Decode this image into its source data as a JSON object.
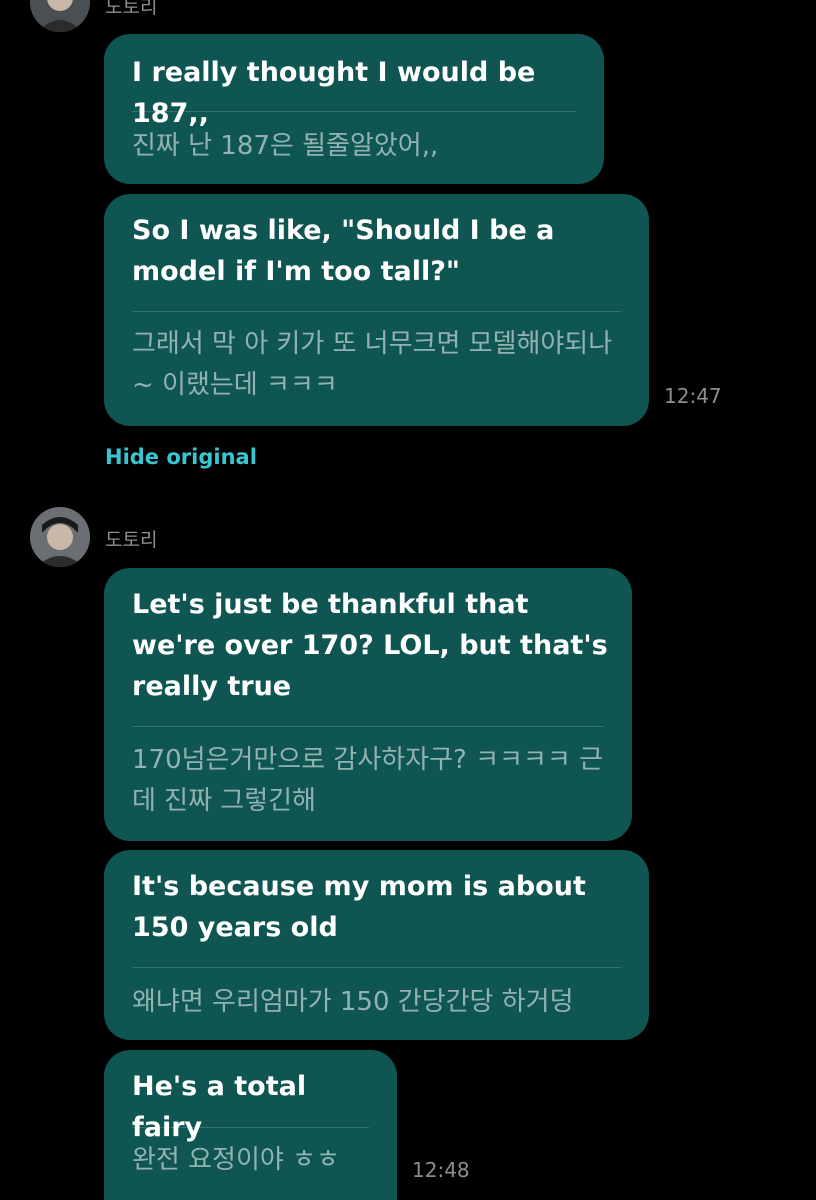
{
  "messages_top": {
    "sender_name": "도토리",
    "bubbles": [
      {
        "english": "I really thought I would be 187,,",
        "original": "진짜 난 187은 될줄알았어,,"
      },
      {
        "english": "So I was like, \"Should I be a model if I'm too tall?\"",
        "original": "그래서 막 아 키가 또 너무크면 모델해야되나~ 이랬는데 ㅋㅋㅋ"
      }
    ],
    "timestamp": "12:47",
    "hide_original_label": "Hide original"
  },
  "messages_bottom": {
    "sender_name": "도토리",
    "bubbles": [
      {
        "english": "Let's just be thankful that we're over 170? LOL, but that's really true",
        "original": "170넘은거만으로 감사하자구? ㅋㅋㅋㅋ 근데 진짜 그렇긴해"
      },
      {
        "english": "It's because my mom is about 150 years old",
        "original": "왜냐면 우리엄마가 150 간당간당 하거덩"
      },
      {
        "english": "He's a total fairy",
        "original": "완전 요정이야 ㅎㅎ"
      }
    ],
    "timestamp": "12:48"
  },
  "colors": {
    "background": "#000000",
    "bubble": "#0f5552",
    "link": "#37c7d3",
    "meta_text": "#8a8f93"
  }
}
